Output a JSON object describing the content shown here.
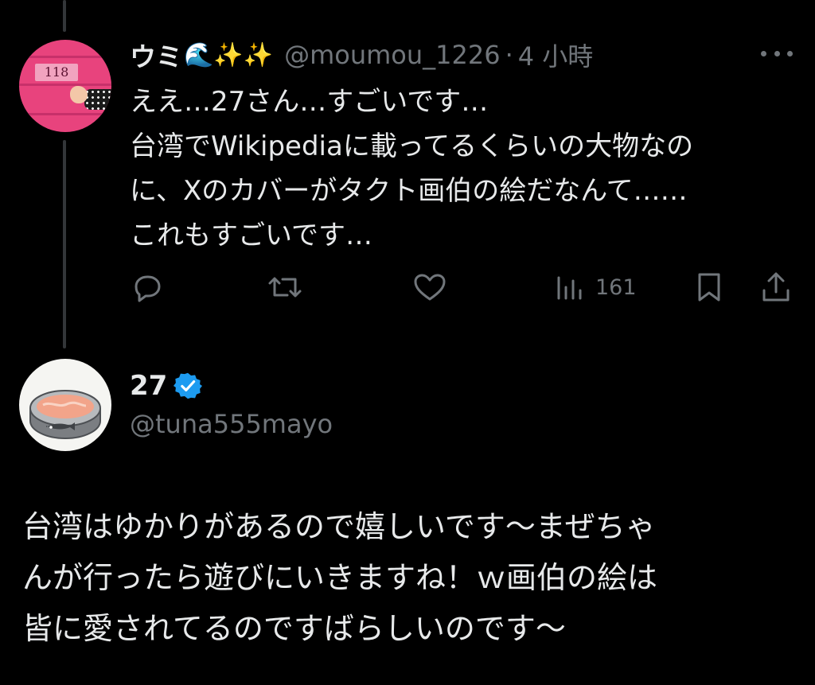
{
  "tweet": {
    "display_name": "ウミ",
    "name_emojis": "🌊✨✨",
    "handle": "@moumou_1226",
    "separator": "·",
    "time": "4 小時",
    "avatar_text": "118",
    "body_lines": [
      "ええ…27さん…すごいです…",
      "台湾でWikipediaに載ってるくらいの大物なの",
      "に、Xのカバーがタクト画伯の絵だなんて……",
      "これもすごいです…"
    ],
    "actions": {
      "reply_icon": "reply-icon",
      "repost_icon": "repost-icon",
      "like_icon": "heart-icon",
      "views_icon": "views-icon",
      "views_count": "161",
      "bookmark_icon": "bookmark-icon",
      "share_icon": "share-icon"
    }
  },
  "reply": {
    "display_name": "27",
    "handle": "@tuna555mayo",
    "verified": true,
    "body_lines": [
      "台湾はゆかりがあるので嬉しいです～まぜちゃ",
      "んが行ったら遊びにいきますね！ｗ画伯の絵は",
      "皆に愛されてるのですばらしいのです～"
    ]
  },
  "colors": {
    "background": "#000000",
    "text": "#e7e9ea",
    "secondary": "#71767b",
    "verified": "#1d9bf0",
    "thread_line": "#333639"
  }
}
